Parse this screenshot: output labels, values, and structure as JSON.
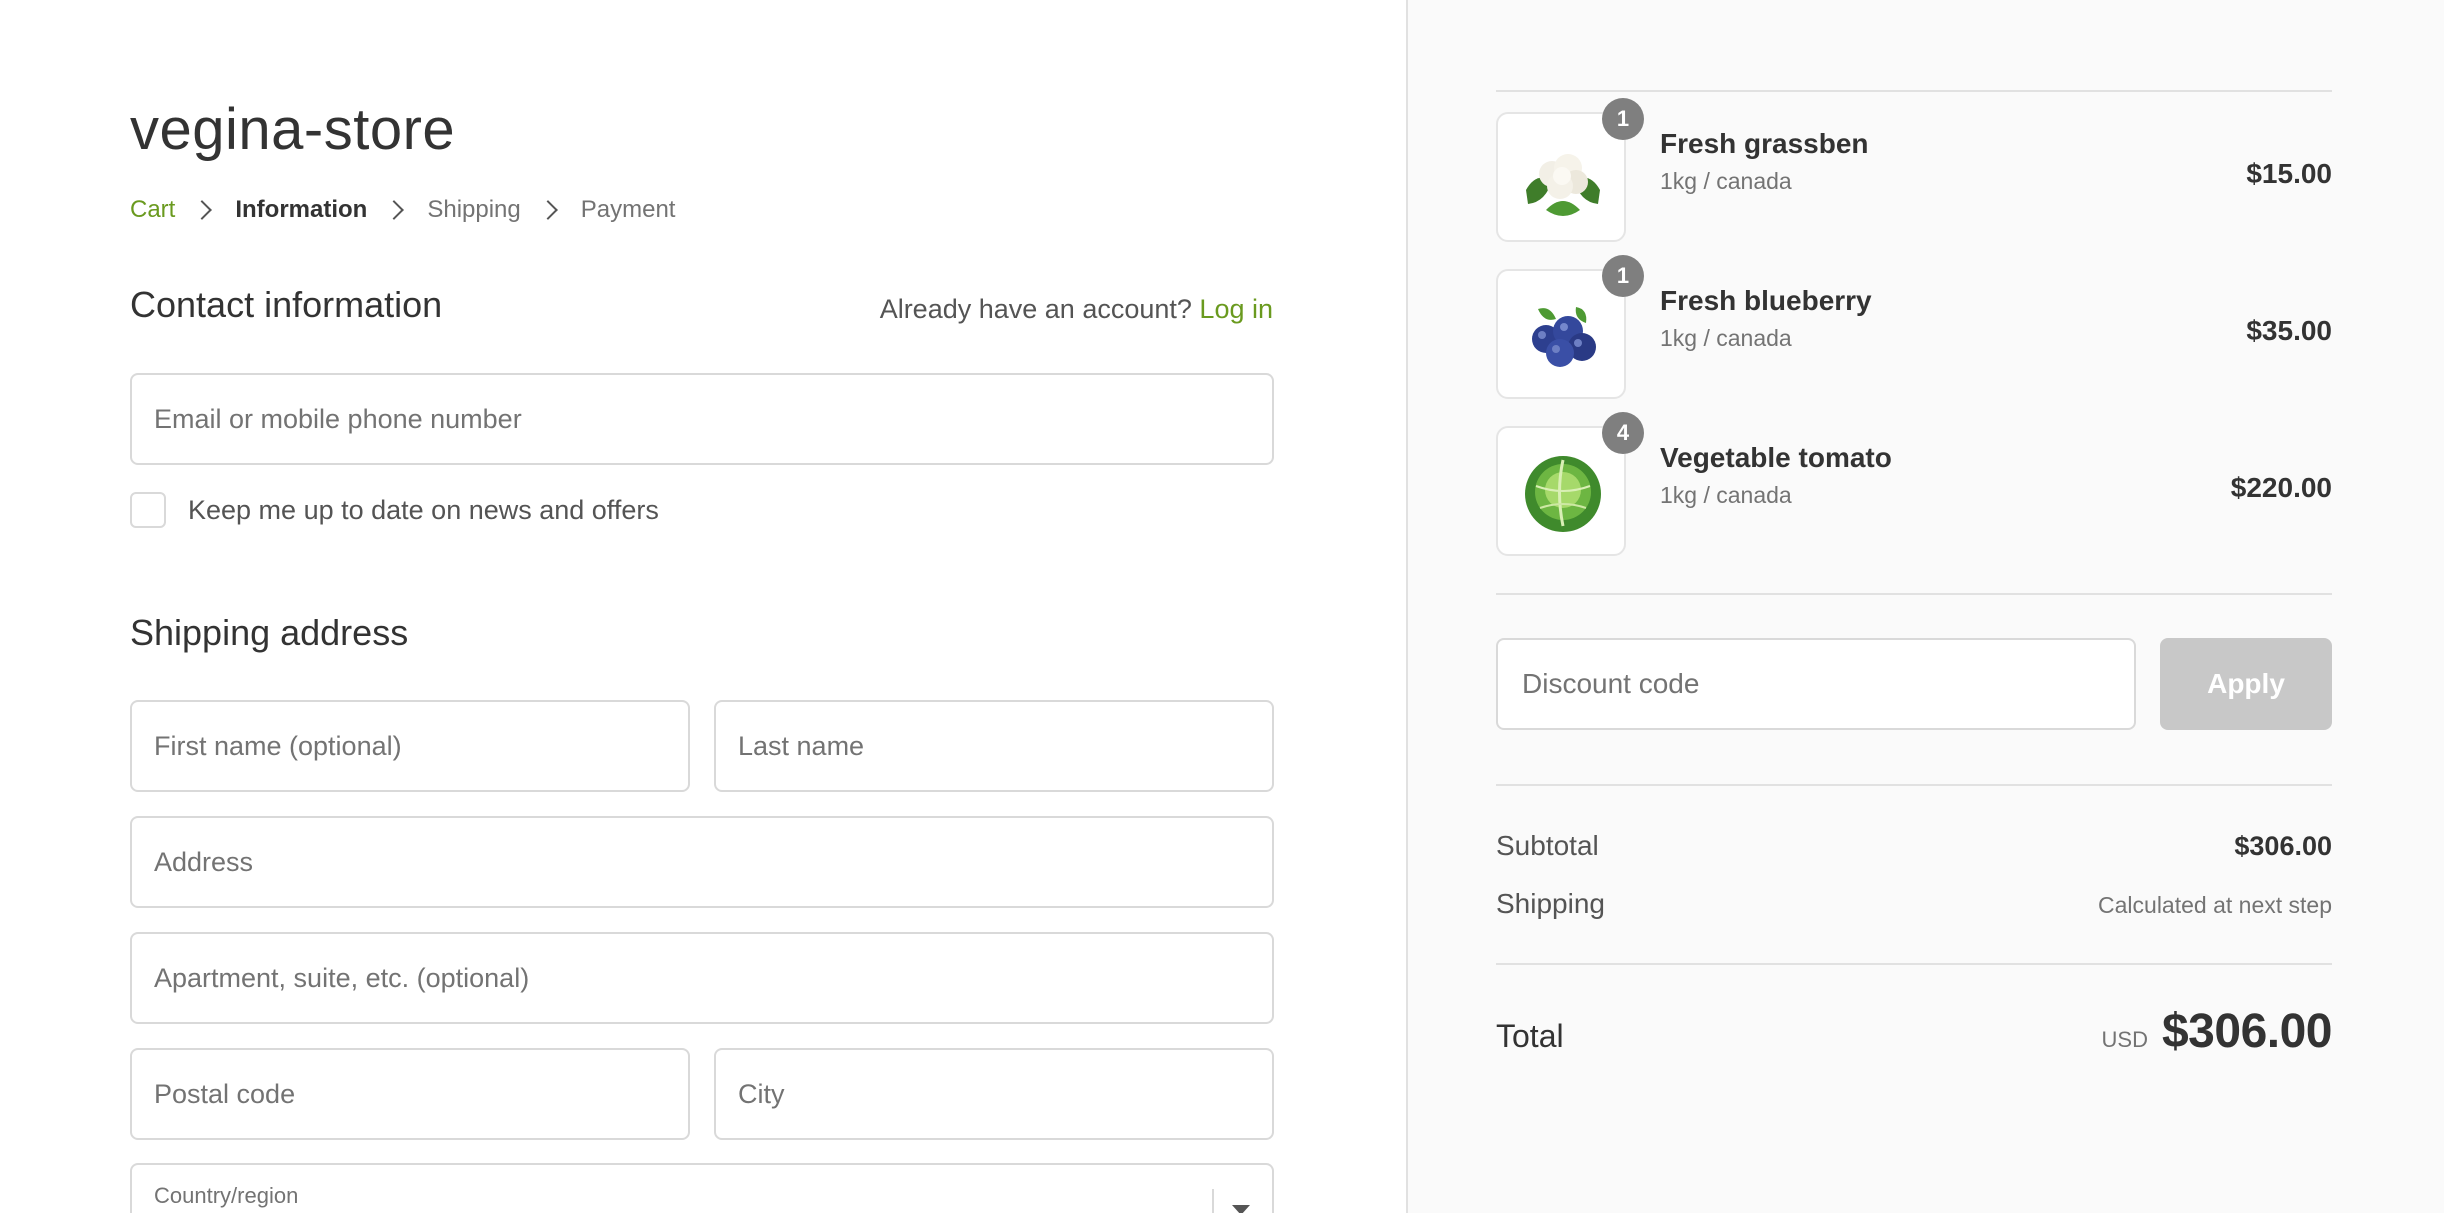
{
  "store": {
    "name": "vegina-store"
  },
  "breadcrumb": [
    {
      "label": "Cart"
    },
    {
      "label": "Information"
    },
    {
      "label": "Shipping"
    },
    {
      "label": "Payment"
    }
  ],
  "contact": {
    "title": "Contact information",
    "account_prompt": "Already have an account?",
    "login_label": "Log in",
    "email_placeholder": "Email or mobile phone number",
    "newsletter_label": "Keep me up to date on news and offers",
    "newsletter_checked": false
  },
  "shipping": {
    "title": "Shipping address",
    "first_name_placeholder": "First name (optional)",
    "last_name_placeholder": "Last name",
    "address_placeholder": "Address",
    "apartment_placeholder": "Apartment, suite, etc. (optional)",
    "postal_placeholder": "Postal code",
    "city_placeholder": "City",
    "country_label": "Country/region"
  },
  "order": {
    "items": [
      {
        "name": "Fresh grassben",
        "variant": "1kg / canada",
        "price": "$15.00",
        "quantity": "1",
        "icon": "cauliflower-icon"
      },
      {
        "name": "Fresh blueberry",
        "variant": "1kg / canada",
        "price": "$35.00",
        "quantity": "1",
        "icon": "blueberry-icon"
      },
      {
        "name": "Vegetable tomato",
        "variant": "1kg / canada",
        "price": "$220.00",
        "quantity": "4",
        "icon": "cabbage-icon"
      }
    ],
    "discount_placeholder": "Discount code",
    "apply_label": "Apply",
    "subtotal_label": "Subtotal",
    "subtotal_value": "$306.00",
    "shipping_label": "Shipping",
    "shipping_value": "Calculated at next step",
    "total_label": "Total",
    "currency": "USD",
    "total_value": "$306.00"
  },
  "colors": {
    "accent": "#6a9a1f",
    "sidebar_bg": "#fafafa",
    "badge": "#7f7f7f",
    "apply_disabled": "#c8c8c8"
  }
}
